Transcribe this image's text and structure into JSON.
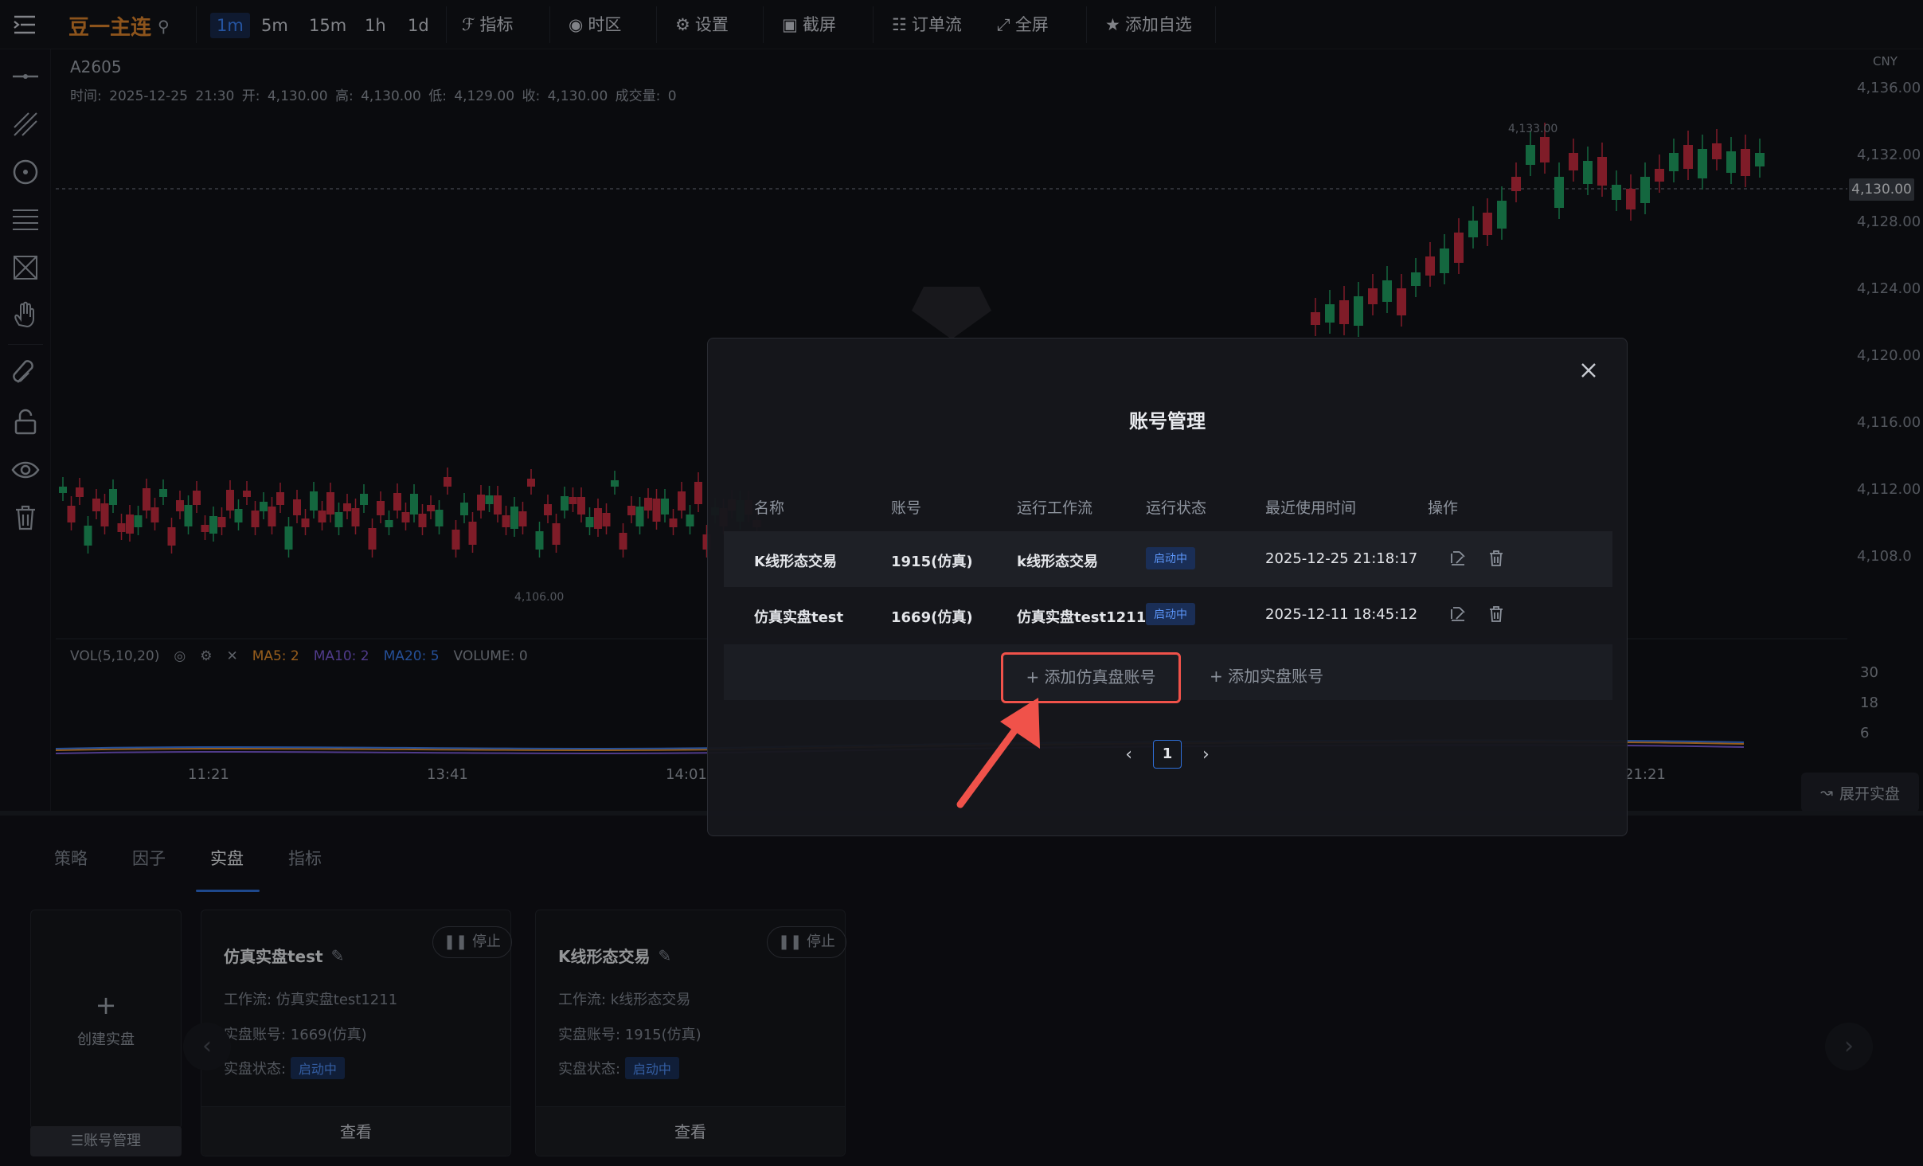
{
  "brand": {
    "name": "豆一主连"
  },
  "timeframes": [
    "1m",
    "5m",
    "15m",
    "1h",
    "1d"
  ],
  "active_timeframe": "1m",
  "toolbar": {
    "indicator": "指标",
    "timezone": "时区",
    "settings": "设置",
    "screenshot": "截屏",
    "orderflow": "订单流",
    "fullscreen": "全屏",
    "watchlist": "添加自选"
  },
  "chart": {
    "symbol": "A2605",
    "ohlc": "时间: 2025-12-25 21:30   开: 4,130.00   高: 4,130.00   低: 4,129.00   收: 4,130.00   成交量: 0",
    "currency": "CNY",
    "price_ticks": [
      "4,136.00",
      "4,132.00",
      "4,128.00",
      "4,124.00",
      "4,120.00",
      "4,116.00",
      "4,112.00",
      "4,108.0"
    ],
    "current_price": "4,130.00",
    "high_marker": "4,133.00",
    "low_marker": "4,106.00",
    "volume_header": {
      "label": "VOL(5,10,20)",
      "ma5": "MA5: 2",
      "ma10": "MA10: 2",
      "ma20": "MA20: 5",
      "volume": "VOLUME: 0"
    },
    "volume_ticks": [
      "30",
      "18",
      "6"
    ],
    "time_ticks": [
      "11:21",
      "13:41",
      "14:01",
      "21:21"
    ],
    "colors": {
      "up": "#c42b3e",
      "down": "#1f9e62",
      "ma5": "#e8902c",
      "ma10": "#7b5bd6",
      "ma20": "#3a7ae8"
    }
  },
  "bottom": {
    "tabs": [
      "策略",
      "因子",
      "实盘",
      "指标"
    ],
    "active_tab": "实盘",
    "create_label": "创建实盘",
    "account_mgmt": "账号管理",
    "expand": "展开实盘",
    "cards": [
      {
        "title": "仿真实盘test",
        "stop": "停止",
        "workflow": "工作流: 仿真实盘test1211",
        "account": "实盘账号: 1669(仿真)",
        "status_label": "实盘状态:",
        "status": "启动中",
        "view": "查看"
      },
      {
        "title": "K线形态交易",
        "stop": "停止",
        "workflow": "工作流: k线形态交易",
        "account": "实盘账号: 1915(仿真)",
        "status_label": "实盘状态:",
        "status": "启动中",
        "view": "查看"
      }
    ]
  },
  "modal": {
    "title": "账号管理",
    "columns": [
      "名称",
      "账号",
      "运行工作流",
      "运行状态",
      "最近使用时间",
      "操作"
    ],
    "rows": [
      {
        "name": "K线形态交易",
        "account": "1915(仿真)",
        "workflow": "k线形态交易",
        "status": "启动中",
        "last_used": "2025-12-25 21:18:17"
      },
      {
        "name": "仿真实盘test",
        "account": "1669(仿真)",
        "workflow": "仿真实盘test1211",
        "status": "启动中",
        "last_used": "2025-12-11 18:45:12"
      }
    ],
    "add_sim": "+ 添加仿真盘账号",
    "add_live": "+ 添加实盘账号",
    "page": "1"
  }
}
